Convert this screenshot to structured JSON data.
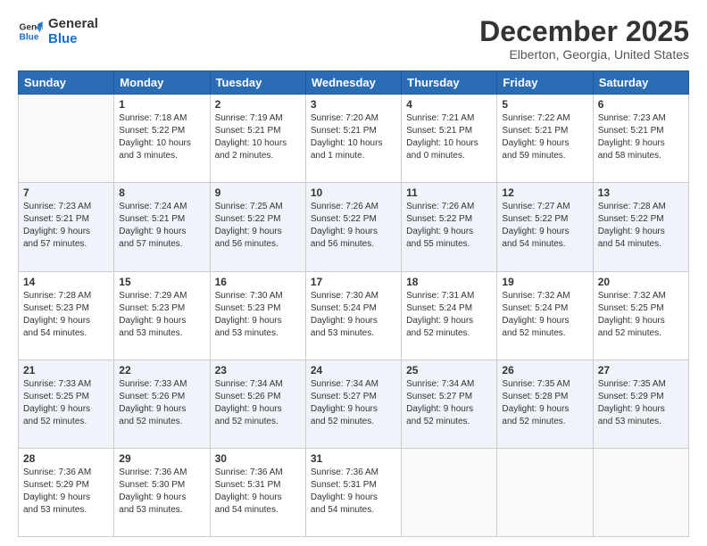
{
  "logo": {
    "line1": "General",
    "line2": "Blue"
  },
  "title": "December 2025",
  "location": "Elberton, Georgia, United States",
  "days_header": [
    "Sunday",
    "Monday",
    "Tuesday",
    "Wednesday",
    "Thursday",
    "Friday",
    "Saturday"
  ],
  "weeks": [
    [
      {
        "day": "",
        "info": ""
      },
      {
        "day": "1",
        "info": "Sunrise: 7:18 AM\nSunset: 5:22 PM\nDaylight: 10 hours\nand 3 minutes."
      },
      {
        "day": "2",
        "info": "Sunrise: 7:19 AM\nSunset: 5:21 PM\nDaylight: 10 hours\nand 2 minutes."
      },
      {
        "day": "3",
        "info": "Sunrise: 7:20 AM\nSunset: 5:21 PM\nDaylight: 10 hours\nand 1 minute."
      },
      {
        "day": "4",
        "info": "Sunrise: 7:21 AM\nSunset: 5:21 PM\nDaylight: 10 hours\nand 0 minutes."
      },
      {
        "day": "5",
        "info": "Sunrise: 7:22 AM\nSunset: 5:21 PM\nDaylight: 9 hours\nand 59 minutes."
      },
      {
        "day": "6",
        "info": "Sunrise: 7:23 AM\nSunset: 5:21 PM\nDaylight: 9 hours\nand 58 minutes."
      }
    ],
    [
      {
        "day": "7",
        "info": "Sunrise: 7:23 AM\nSunset: 5:21 PM\nDaylight: 9 hours\nand 57 minutes."
      },
      {
        "day": "8",
        "info": "Sunrise: 7:24 AM\nSunset: 5:21 PM\nDaylight: 9 hours\nand 57 minutes."
      },
      {
        "day": "9",
        "info": "Sunrise: 7:25 AM\nSunset: 5:22 PM\nDaylight: 9 hours\nand 56 minutes."
      },
      {
        "day": "10",
        "info": "Sunrise: 7:26 AM\nSunset: 5:22 PM\nDaylight: 9 hours\nand 56 minutes."
      },
      {
        "day": "11",
        "info": "Sunrise: 7:26 AM\nSunset: 5:22 PM\nDaylight: 9 hours\nand 55 minutes."
      },
      {
        "day": "12",
        "info": "Sunrise: 7:27 AM\nSunset: 5:22 PM\nDaylight: 9 hours\nand 54 minutes."
      },
      {
        "day": "13",
        "info": "Sunrise: 7:28 AM\nSunset: 5:22 PM\nDaylight: 9 hours\nand 54 minutes."
      }
    ],
    [
      {
        "day": "14",
        "info": "Sunrise: 7:28 AM\nSunset: 5:23 PM\nDaylight: 9 hours\nand 54 minutes."
      },
      {
        "day": "15",
        "info": "Sunrise: 7:29 AM\nSunset: 5:23 PM\nDaylight: 9 hours\nand 53 minutes."
      },
      {
        "day": "16",
        "info": "Sunrise: 7:30 AM\nSunset: 5:23 PM\nDaylight: 9 hours\nand 53 minutes."
      },
      {
        "day": "17",
        "info": "Sunrise: 7:30 AM\nSunset: 5:24 PM\nDaylight: 9 hours\nand 53 minutes."
      },
      {
        "day": "18",
        "info": "Sunrise: 7:31 AM\nSunset: 5:24 PM\nDaylight: 9 hours\nand 52 minutes."
      },
      {
        "day": "19",
        "info": "Sunrise: 7:32 AM\nSunset: 5:24 PM\nDaylight: 9 hours\nand 52 minutes."
      },
      {
        "day": "20",
        "info": "Sunrise: 7:32 AM\nSunset: 5:25 PM\nDaylight: 9 hours\nand 52 minutes."
      }
    ],
    [
      {
        "day": "21",
        "info": "Sunrise: 7:33 AM\nSunset: 5:25 PM\nDaylight: 9 hours\nand 52 minutes."
      },
      {
        "day": "22",
        "info": "Sunrise: 7:33 AM\nSunset: 5:26 PM\nDaylight: 9 hours\nand 52 minutes."
      },
      {
        "day": "23",
        "info": "Sunrise: 7:34 AM\nSunset: 5:26 PM\nDaylight: 9 hours\nand 52 minutes."
      },
      {
        "day": "24",
        "info": "Sunrise: 7:34 AM\nSunset: 5:27 PM\nDaylight: 9 hours\nand 52 minutes."
      },
      {
        "day": "25",
        "info": "Sunrise: 7:34 AM\nSunset: 5:27 PM\nDaylight: 9 hours\nand 52 minutes."
      },
      {
        "day": "26",
        "info": "Sunrise: 7:35 AM\nSunset: 5:28 PM\nDaylight: 9 hours\nand 52 minutes."
      },
      {
        "day": "27",
        "info": "Sunrise: 7:35 AM\nSunset: 5:29 PM\nDaylight: 9 hours\nand 53 minutes."
      }
    ],
    [
      {
        "day": "28",
        "info": "Sunrise: 7:36 AM\nSunset: 5:29 PM\nDaylight: 9 hours\nand 53 minutes."
      },
      {
        "day": "29",
        "info": "Sunrise: 7:36 AM\nSunset: 5:30 PM\nDaylight: 9 hours\nand 53 minutes."
      },
      {
        "day": "30",
        "info": "Sunrise: 7:36 AM\nSunset: 5:31 PM\nDaylight: 9 hours\nand 54 minutes."
      },
      {
        "day": "31",
        "info": "Sunrise: 7:36 AM\nSunset: 5:31 PM\nDaylight: 9 hours\nand 54 minutes."
      },
      {
        "day": "",
        "info": ""
      },
      {
        "day": "",
        "info": ""
      },
      {
        "day": "",
        "info": ""
      }
    ]
  ]
}
